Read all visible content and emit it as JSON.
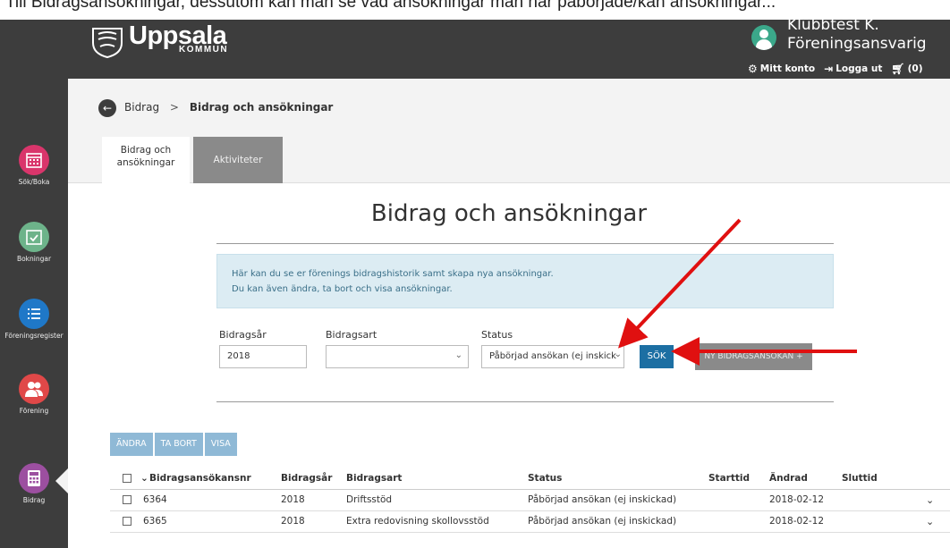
{
  "caption": "Till Bidragsansökningar, dessutom kan man se vad ansökningar man har påbörjade/kan ansökningar...",
  "header": {
    "logo_name": "Uppsala",
    "logo_sub": "KOMMUN",
    "user_name": "Klubbtest K.",
    "user_role": "Föreningsansvarig",
    "links": {
      "account": "Mitt konto",
      "logout": "Logga ut",
      "cart": "(0)"
    }
  },
  "sidebar": {
    "items": [
      {
        "label": "Sök/Boka",
        "color": "#d9356b",
        "icon": "calendar-grid-icon"
      },
      {
        "label": "Bokningar",
        "color": "#6db38a",
        "icon": "calendar-check-icon"
      },
      {
        "label": "Föreningsregister",
        "color": "#1f78c8",
        "icon": "list-icon"
      },
      {
        "label": "Förening",
        "color": "#e04848",
        "icon": "people-icon"
      },
      {
        "label": "Bidrag",
        "color": "#9c4fa0",
        "icon": "calculator-icon"
      }
    ]
  },
  "breadcrumb": {
    "parent": "Bidrag",
    "separator": ">",
    "current": "Bidrag och ansökningar"
  },
  "tabs": [
    {
      "label": "Bidrag och ansökningar"
    },
    {
      "label": "Aktiviteter"
    }
  ],
  "page": {
    "title": "Bidrag och ansökningar",
    "info_line1": "Här kan du se er förenings bidragshistorik samt skapa nya ansökningar.",
    "info_line2": "Du kan även ändra, ta bort och visa ansökningar."
  },
  "filters": {
    "year_label": "Bidragsår",
    "year_value": "2018",
    "type_label": "Bidragsart",
    "type_value": "",
    "status_label": "Status",
    "status_value": "Påbörjad ansökan (ej inskick"
  },
  "buttons": {
    "search": "SÖK",
    "new_application": "NY BIDRAGSANSÖKAN +",
    "edit": "ÄNDRA",
    "delete": "TA BORT",
    "view": "VISA"
  },
  "table": {
    "columns": [
      "Bidragsansökansnr",
      "Bidragsår",
      "Bidragsart",
      "Status",
      "Starttid",
      "Ändrad",
      "Sluttid"
    ],
    "rows": [
      {
        "nr": "6364",
        "year": "2018",
        "type": "Driftsstöd",
        "status": "Påbörjad ansökan (ej inskickad)",
        "start": "",
        "changed": "2018-02-12",
        "end": ""
      },
      {
        "nr": "6365",
        "year": "2018",
        "type": "Extra redovisning skollovsstöd",
        "status": "Påbörjad ansökan (ej inskickad)",
        "start": "",
        "changed": "2018-02-12",
        "end": ""
      }
    ]
  },
  "colors": {
    "header_bg": "#3d3d3d",
    "sok_button": "#1c6fa3",
    "info_bg": "#dcecf3",
    "annotation": "#e01010"
  }
}
